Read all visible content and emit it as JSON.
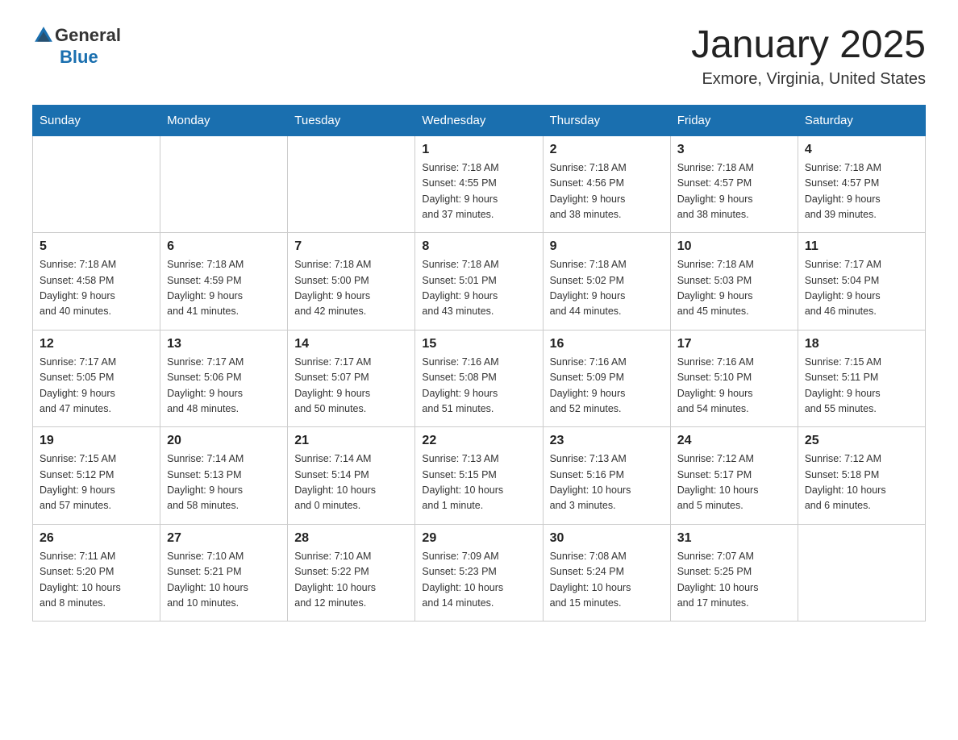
{
  "header": {
    "logo_general": "General",
    "logo_blue": "Blue",
    "title": "January 2025",
    "subtitle": "Exmore, Virginia, United States"
  },
  "days_of_week": [
    "Sunday",
    "Monday",
    "Tuesday",
    "Wednesday",
    "Thursday",
    "Friday",
    "Saturday"
  ],
  "weeks": [
    [
      {
        "day": "",
        "info": ""
      },
      {
        "day": "",
        "info": ""
      },
      {
        "day": "",
        "info": ""
      },
      {
        "day": "1",
        "info": "Sunrise: 7:18 AM\nSunset: 4:55 PM\nDaylight: 9 hours\nand 37 minutes."
      },
      {
        "day": "2",
        "info": "Sunrise: 7:18 AM\nSunset: 4:56 PM\nDaylight: 9 hours\nand 38 minutes."
      },
      {
        "day": "3",
        "info": "Sunrise: 7:18 AM\nSunset: 4:57 PM\nDaylight: 9 hours\nand 38 minutes."
      },
      {
        "day": "4",
        "info": "Sunrise: 7:18 AM\nSunset: 4:57 PM\nDaylight: 9 hours\nand 39 minutes."
      }
    ],
    [
      {
        "day": "5",
        "info": "Sunrise: 7:18 AM\nSunset: 4:58 PM\nDaylight: 9 hours\nand 40 minutes."
      },
      {
        "day": "6",
        "info": "Sunrise: 7:18 AM\nSunset: 4:59 PM\nDaylight: 9 hours\nand 41 minutes."
      },
      {
        "day": "7",
        "info": "Sunrise: 7:18 AM\nSunset: 5:00 PM\nDaylight: 9 hours\nand 42 minutes."
      },
      {
        "day": "8",
        "info": "Sunrise: 7:18 AM\nSunset: 5:01 PM\nDaylight: 9 hours\nand 43 minutes."
      },
      {
        "day": "9",
        "info": "Sunrise: 7:18 AM\nSunset: 5:02 PM\nDaylight: 9 hours\nand 44 minutes."
      },
      {
        "day": "10",
        "info": "Sunrise: 7:18 AM\nSunset: 5:03 PM\nDaylight: 9 hours\nand 45 minutes."
      },
      {
        "day": "11",
        "info": "Sunrise: 7:17 AM\nSunset: 5:04 PM\nDaylight: 9 hours\nand 46 minutes."
      }
    ],
    [
      {
        "day": "12",
        "info": "Sunrise: 7:17 AM\nSunset: 5:05 PM\nDaylight: 9 hours\nand 47 minutes."
      },
      {
        "day": "13",
        "info": "Sunrise: 7:17 AM\nSunset: 5:06 PM\nDaylight: 9 hours\nand 48 minutes."
      },
      {
        "day": "14",
        "info": "Sunrise: 7:17 AM\nSunset: 5:07 PM\nDaylight: 9 hours\nand 50 minutes."
      },
      {
        "day": "15",
        "info": "Sunrise: 7:16 AM\nSunset: 5:08 PM\nDaylight: 9 hours\nand 51 minutes."
      },
      {
        "day": "16",
        "info": "Sunrise: 7:16 AM\nSunset: 5:09 PM\nDaylight: 9 hours\nand 52 minutes."
      },
      {
        "day": "17",
        "info": "Sunrise: 7:16 AM\nSunset: 5:10 PM\nDaylight: 9 hours\nand 54 minutes."
      },
      {
        "day": "18",
        "info": "Sunrise: 7:15 AM\nSunset: 5:11 PM\nDaylight: 9 hours\nand 55 minutes."
      }
    ],
    [
      {
        "day": "19",
        "info": "Sunrise: 7:15 AM\nSunset: 5:12 PM\nDaylight: 9 hours\nand 57 minutes."
      },
      {
        "day": "20",
        "info": "Sunrise: 7:14 AM\nSunset: 5:13 PM\nDaylight: 9 hours\nand 58 minutes."
      },
      {
        "day": "21",
        "info": "Sunrise: 7:14 AM\nSunset: 5:14 PM\nDaylight: 10 hours\nand 0 minutes."
      },
      {
        "day": "22",
        "info": "Sunrise: 7:13 AM\nSunset: 5:15 PM\nDaylight: 10 hours\nand 1 minute."
      },
      {
        "day": "23",
        "info": "Sunrise: 7:13 AM\nSunset: 5:16 PM\nDaylight: 10 hours\nand 3 minutes."
      },
      {
        "day": "24",
        "info": "Sunrise: 7:12 AM\nSunset: 5:17 PM\nDaylight: 10 hours\nand 5 minutes."
      },
      {
        "day": "25",
        "info": "Sunrise: 7:12 AM\nSunset: 5:18 PM\nDaylight: 10 hours\nand 6 minutes."
      }
    ],
    [
      {
        "day": "26",
        "info": "Sunrise: 7:11 AM\nSunset: 5:20 PM\nDaylight: 10 hours\nand 8 minutes."
      },
      {
        "day": "27",
        "info": "Sunrise: 7:10 AM\nSunset: 5:21 PM\nDaylight: 10 hours\nand 10 minutes."
      },
      {
        "day": "28",
        "info": "Sunrise: 7:10 AM\nSunset: 5:22 PM\nDaylight: 10 hours\nand 12 minutes."
      },
      {
        "day": "29",
        "info": "Sunrise: 7:09 AM\nSunset: 5:23 PM\nDaylight: 10 hours\nand 14 minutes."
      },
      {
        "day": "30",
        "info": "Sunrise: 7:08 AM\nSunset: 5:24 PM\nDaylight: 10 hours\nand 15 minutes."
      },
      {
        "day": "31",
        "info": "Sunrise: 7:07 AM\nSunset: 5:25 PM\nDaylight: 10 hours\nand 17 minutes."
      },
      {
        "day": "",
        "info": ""
      }
    ]
  ]
}
